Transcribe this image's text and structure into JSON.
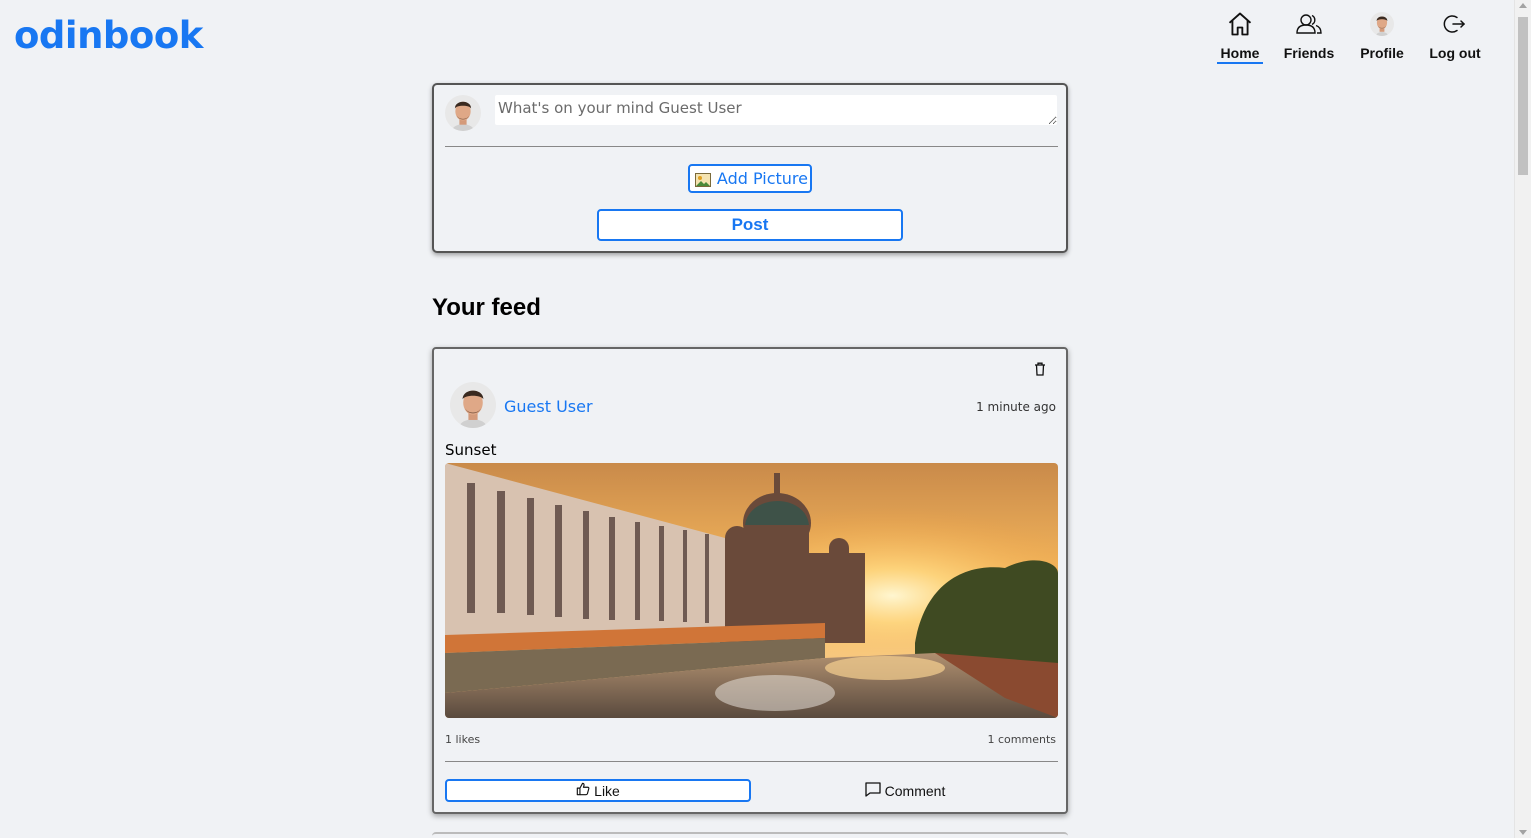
{
  "app": {
    "logo": "odinbook"
  },
  "nav": [
    {
      "label": "Home",
      "icon": "home-icon",
      "active": true
    },
    {
      "label": "Friends",
      "icon": "friends-icon",
      "active": false
    },
    {
      "label": "Profile",
      "icon": "avatar",
      "active": false
    },
    {
      "label": "Log out",
      "icon": "logout-icon",
      "active": false
    }
  ],
  "composer": {
    "placeholder": "What's on your mind Guest User",
    "add_picture_label": "Add Picture",
    "post_label": "Post"
  },
  "feed": {
    "title": "Your feed",
    "posts": [
      {
        "author": "Guest User",
        "time": "1 minute ago",
        "text": "Sunset",
        "likes": "1 likes",
        "comments": "1 comments",
        "like_label": "Like",
        "comment_label": "Comment"
      }
    ]
  },
  "colors": {
    "accent": "#1877f2",
    "background": "#f0f2f5"
  }
}
